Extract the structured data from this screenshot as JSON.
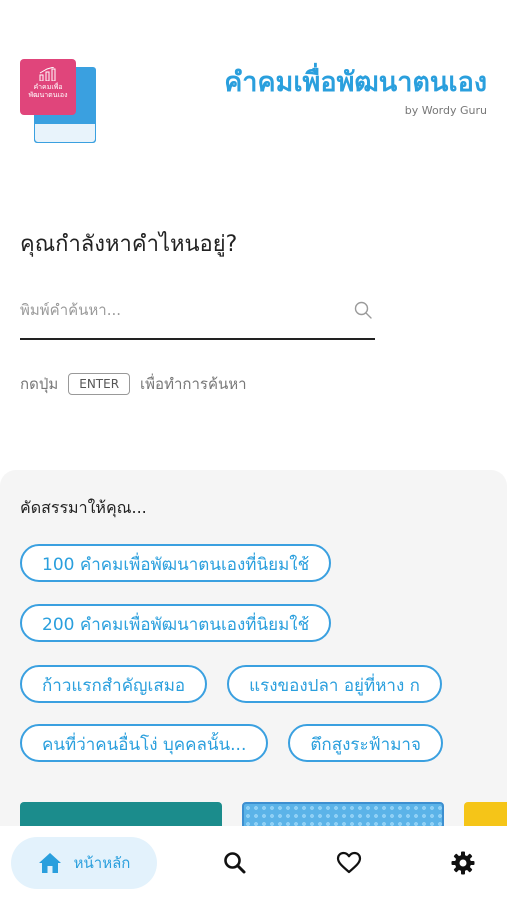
{
  "header": {
    "title": "คำคมเพื่อพัฒนาตนเอง",
    "subtitle": "by Wordy Guru",
    "logo_text": "คำคมเพื่อ\nพัฒนาตนเอง"
  },
  "search": {
    "question": "คุณกำลังหาคำไหนอยู่?",
    "placeholder": "พิมพ์คำค้นหา...",
    "value": "",
    "hint_before": "กดปุ่ม",
    "hint_key": "ENTER",
    "hint_after": "เพื่อทำการค้นหา",
    "icon": "search-icon"
  },
  "suggestions": {
    "title": "คัดสรรมาให้คุณ...",
    "chips": [
      "100 คำคมเพื่อพัฒนาตนเองที่นิยมใช้",
      "200 คำคมเพื่อพัฒนาตนเองที่นิยมใช้",
      "ก้าวแรกสำคัญเสมอ",
      "แรงของปลา อยู่ที่หาง ก",
      "คนที่ว่าคนอื่นโง่ บุคคลนั้น...",
      "ตึกสูงระฟ้ามาจ"
    ]
  },
  "nav": {
    "home_label": "หน้าหลัก",
    "items": [
      "home-icon",
      "search-icon",
      "heart-icon",
      "gear-icon"
    ]
  },
  "colors": {
    "accent": "#2a9fdd",
    "logo_pink": "#e0457b",
    "panel_bg": "#f5f5f5",
    "home_pill": "#e3f2fc"
  }
}
